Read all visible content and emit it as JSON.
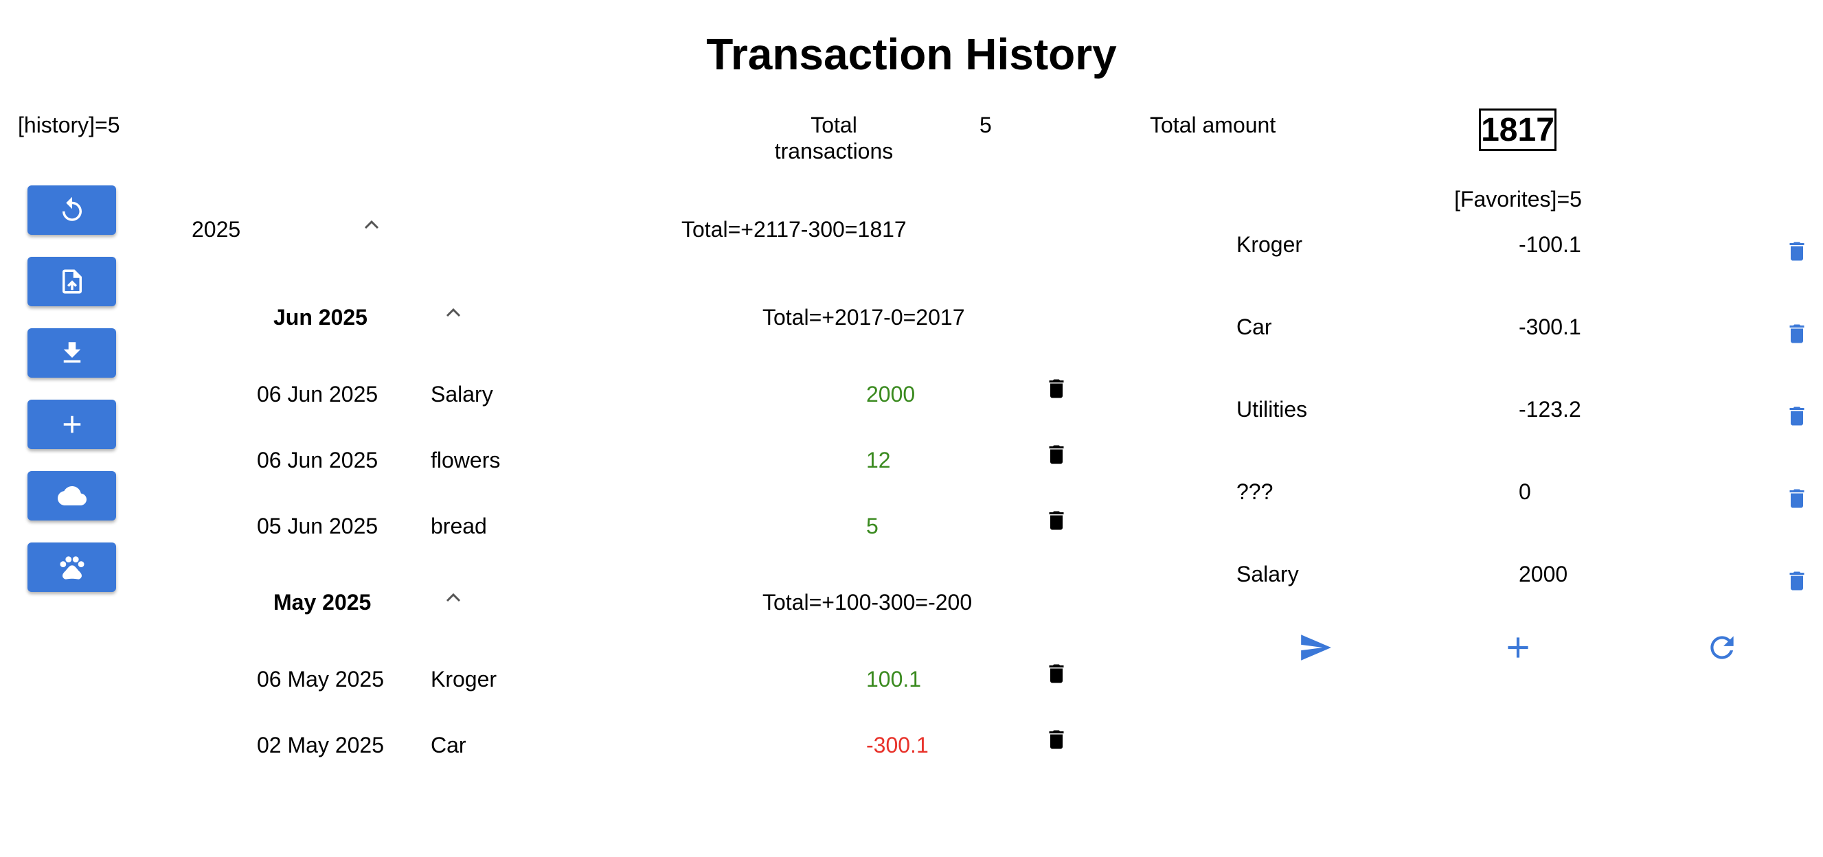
{
  "page": {
    "title": "Transaction History"
  },
  "summary": {
    "history_count": "[history]=5",
    "total_transactions_label_line1": "Total",
    "total_transactions_label_line2": "transactions",
    "total_transactions_value": "5",
    "total_amount_label": "Total amount",
    "total_amount_value": "1817"
  },
  "sidebar": {
    "buttons": [
      {
        "icon": "refresh-icon"
      },
      {
        "icon": "file-upload-icon"
      },
      {
        "icon": "download-icon"
      },
      {
        "icon": "plus-icon"
      },
      {
        "icon": "cloud-icon"
      },
      {
        "icon": "paw-icon"
      }
    ]
  },
  "history": {
    "year": {
      "label": "2025",
      "total": "Total=+2117-300=1817"
    },
    "months": [
      {
        "label": "Jun 2025",
        "total": "Total=+2017-0=2017",
        "rows": [
          {
            "date": "06 Jun 2025",
            "name": "Salary",
            "amount": "2000",
            "sign": "positive"
          },
          {
            "date": "06 Jun 2025",
            "name": "flowers",
            "amount": "12",
            "sign": "positive"
          },
          {
            "date": "05 Jun 2025",
            "name": "bread",
            "amount": "5",
            "sign": "positive"
          }
        ]
      },
      {
        "label": "May 2025",
        "total": "Total=+100-300=-200",
        "rows": [
          {
            "date": "06 May 2025",
            "name": "Kroger",
            "amount": "100.1",
            "sign": "positive"
          },
          {
            "date": "02 May 2025",
            "name": "Car",
            "amount": "-300.1",
            "sign": "negative"
          }
        ]
      }
    ]
  },
  "favorites": {
    "header": "[Favorites]=5",
    "items": [
      {
        "name": "Kroger",
        "amount": "-100.1"
      },
      {
        "name": "Car",
        "amount": "-300.1"
      },
      {
        "name": "Utilities",
        "amount": "-123.2"
      },
      {
        "name": "???",
        "amount": "0"
      },
      {
        "name": "Salary",
        "amount": "2000"
      }
    ],
    "actions": [
      "send-icon",
      "plus-icon",
      "refresh-icon"
    ]
  },
  "colors": {
    "accent": "#3b78d8",
    "positive": "#3a8a1f",
    "negative": "#e8322a"
  }
}
